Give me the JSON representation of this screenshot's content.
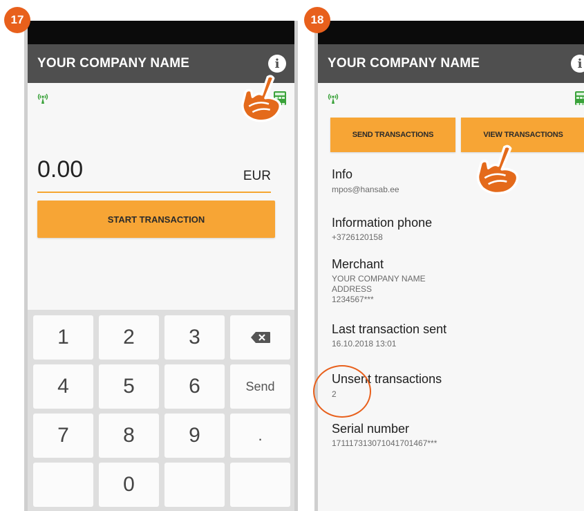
{
  "badges": {
    "left": "17",
    "right": "18"
  },
  "left_screen": {
    "app_title": "YOUR COMPANY NAME",
    "amount": "0.00",
    "currency": "EUR",
    "start_button": "START TRANSACTION",
    "keys": [
      "1",
      "2",
      "3",
      "",
      "4",
      "5",
      "6",
      "Send",
      "7",
      "8",
      "9",
      ".",
      "",
      "0",
      "",
      ""
    ]
  },
  "right_screen": {
    "app_title": "YOUR COMPANY NAME",
    "send_button": "SEND TRANSACTIONS",
    "view_button": "VIEW TRANSACTIONS",
    "info_label": "Info",
    "info_value": "mpos@hansab.ee",
    "phone_label": "Information phone",
    "phone_value": "+3726120158",
    "merchant_label": "Merchant",
    "merchant_name": "YOUR COMPANY NAME",
    "merchant_address": "ADDRESS",
    "merchant_id": "1234567***",
    "last_sent_label": "Last transaction sent",
    "last_sent_value": "16.10.2018 13:01",
    "unsent_label": "Unsent transactions",
    "unsent_value": "2",
    "serial_label": "Serial number",
    "serial_value": "171117313071041701467***"
  },
  "colors": {
    "accent": "#f7a535",
    "badge": "#e8601c",
    "appbar": "#4f4f4f",
    "statusbar": "#0b0b0b",
    "icon_green": "#3aa23a"
  },
  "icons": [
    "info-icon",
    "signal-icon",
    "calculator-icon",
    "backspace-icon",
    "pointing-hand-icon"
  ]
}
